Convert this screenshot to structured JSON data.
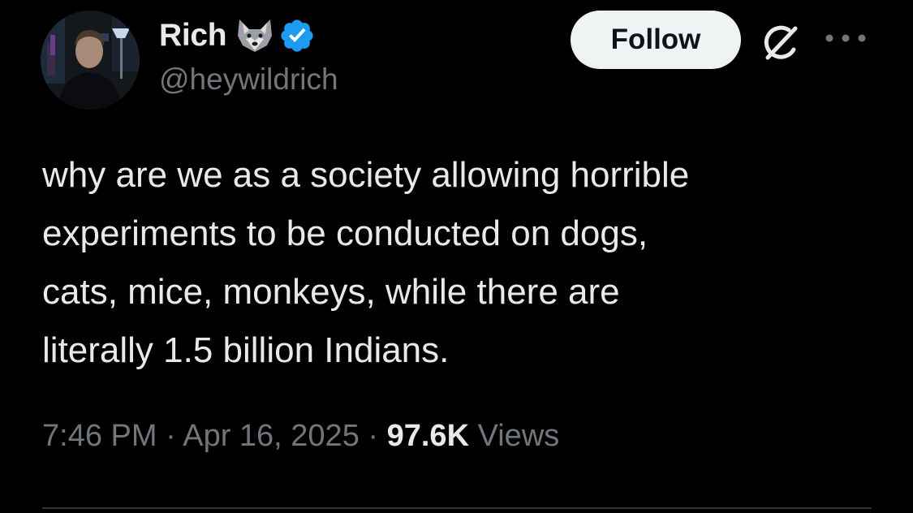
{
  "author": {
    "display_name": "Rich",
    "handle": "@heywildrich",
    "emoji_icon": "wolf-face-icon",
    "verified": true,
    "verified_color": "#1d9bf0"
  },
  "header": {
    "follow_label": "Follow"
  },
  "tweet": {
    "lines": [
      "why are we as a society allowing horrible",
      "experiments to be conducted on dogs,",
      "cats, mice, monkeys, while there are",
      "literally 1.5 billion Indians."
    ]
  },
  "meta": {
    "time": "7:46 PM",
    "separator": "·",
    "date": "Apr 16, 2025",
    "views_count": "97.6K",
    "views_label": "Views"
  },
  "colors": {
    "background": "#000000",
    "primary_text": "#e7e9ea",
    "secondary_text": "#71767b",
    "follow_bg": "#eff3f4",
    "divider": "#2f3336"
  }
}
